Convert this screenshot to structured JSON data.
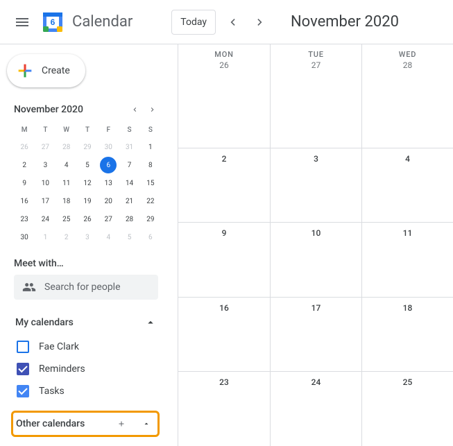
{
  "header": {
    "app_name": "Calendar",
    "logo_day": "6",
    "today_label": "Today",
    "current_view_month": "November 2020"
  },
  "sidebar": {
    "create_label": "Create",
    "mini_cal": {
      "title": "November 2020",
      "dow": [
        "M",
        "T",
        "W",
        "T",
        "F",
        "S",
        "S"
      ],
      "weeks": [
        [
          {
            "n": "26",
            "faded": true
          },
          {
            "n": "27",
            "faded": true
          },
          {
            "n": "28",
            "faded": true
          },
          {
            "n": "29",
            "faded": true
          },
          {
            "n": "30",
            "faded": true
          },
          {
            "n": "31",
            "faded": true
          },
          {
            "n": "1"
          }
        ],
        [
          {
            "n": "2"
          },
          {
            "n": "3"
          },
          {
            "n": "4"
          },
          {
            "n": "5"
          },
          {
            "n": "6",
            "today": true
          },
          {
            "n": "7"
          },
          {
            "n": "8"
          }
        ],
        [
          {
            "n": "9"
          },
          {
            "n": "10"
          },
          {
            "n": "11"
          },
          {
            "n": "12"
          },
          {
            "n": "13"
          },
          {
            "n": "14"
          },
          {
            "n": "15"
          }
        ],
        [
          {
            "n": "16"
          },
          {
            "n": "17"
          },
          {
            "n": "18"
          },
          {
            "n": "19"
          },
          {
            "n": "20"
          },
          {
            "n": "21"
          },
          {
            "n": "22"
          }
        ],
        [
          {
            "n": "23"
          },
          {
            "n": "24"
          },
          {
            "n": "25"
          },
          {
            "n": "26"
          },
          {
            "n": "27"
          },
          {
            "n": "28"
          },
          {
            "n": "29"
          }
        ],
        [
          {
            "n": "30"
          },
          {
            "n": "1",
            "faded": true
          },
          {
            "n": "2",
            "faded": true
          },
          {
            "n": "3",
            "faded": true
          },
          {
            "n": "4",
            "faded": true
          },
          {
            "n": "5",
            "faded": true
          },
          {
            "n": "6",
            "faded": true
          }
        ]
      ]
    },
    "meet_with": {
      "title": "Meet with…",
      "placeholder": "Search for people"
    },
    "my_calendars": {
      "title": "My calendars",
      "items": [
        {
          "label": "Fae Clark",
          "checked": false,
          "color": "#1a73e8"
        },
        {
          "label": "Reminders",
          "checked": true,
          "color": "#3f51b5"
        },
        {
          "label": "Tasks",
          "checked": true,
          "color": "#4285f4"
        }
      ]
    },
    "other_calendars": {
      "title": "Other calendars"
    }
  },
  "grid": {
    "columns": [
      {
        "dow": "MON",
        "day": "26"
      },
      {
        "dow": "TUE",
        "day": "27"
      },
      {
        "dow": "WED",
        "day": "28"
      }
    ],
    "rows": [
      [
        "26",
        "27",
        "28"
      ],
      [
        "2",
        "3",
        "4"
      ],
      [
        "9",
        "10",
        "11"
      ],
      [
        "16",
        "17",
        "18"
      ],
      [
        "23",
        "24",
        "25"
      ]
    ]
  }
}
